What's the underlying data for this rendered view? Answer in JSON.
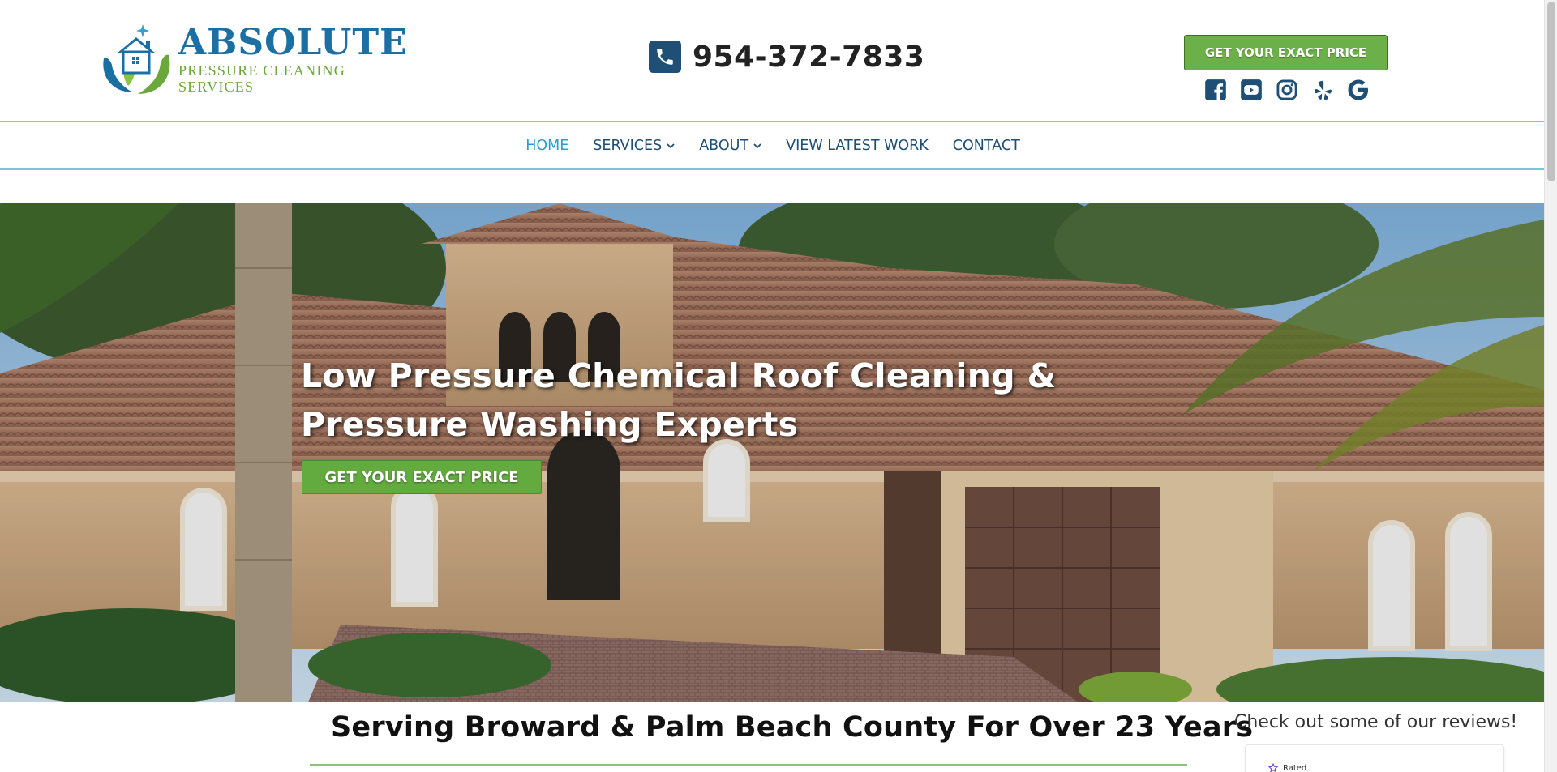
{
  "header": {
    "logo": {
      "name": "ABSOLUTE",
      "subtitle": "PRESSURE CLEANING SERVICES"
    },
    "phone": {
      "icon": "phone-icon",
      "number": "954-372-7833"
    },
    "cta_label": "GET YOUR EXACT PRICE",
    "socials": [
      {
        "name": "facebook-icon"
      },
      {
        "name": "youtube-icon"
      },
      {
        "name": "instagram-icon"
      },
      {
        "name": "yelp-icon"
      },
      {
        "name": "google-icon"
      }
    ]
  },
  "nav": {
    "items": [
      {
        "label": "HOME",
        "active": true,
        "dropdown": false
      },
      {
        "label": "SERVICES",
        "active": false,
        "dropdown": true
      },
      {
        "label": "ABOUT",
        "active": false,
        "dropdown": true
      },
      {
        "label": "VIEW LATEST WORK",
        "active": false,
        "dropdown": false
      },
      {
        "label": "CONTACT",
        "active": false,
        "dropdown": false
      }
    ]
  },
  "hero": {
    "title": "Low Pressure Chemical Roof Cleaning & Pressure Washing Experts",
    "cta_label": "GET YOUR EXACT PRICE"
  },
  "main": {
    "serving_heading": "Serving Broward & Palm Beach County For Over 23 Years"
  },
  "reviews": {
    "heading": "Check out some of our reviews!",
    "rated_label": "Rated"
  },
  "colors": {
    "brand_blue": "#1c6fa3",
    "brand_green": "#6bb048",
    "nav_active": "#2b9cd0",
    "nav_text": "#1e4e72",
    "nav_border": "#79c5d9"
  }
}
